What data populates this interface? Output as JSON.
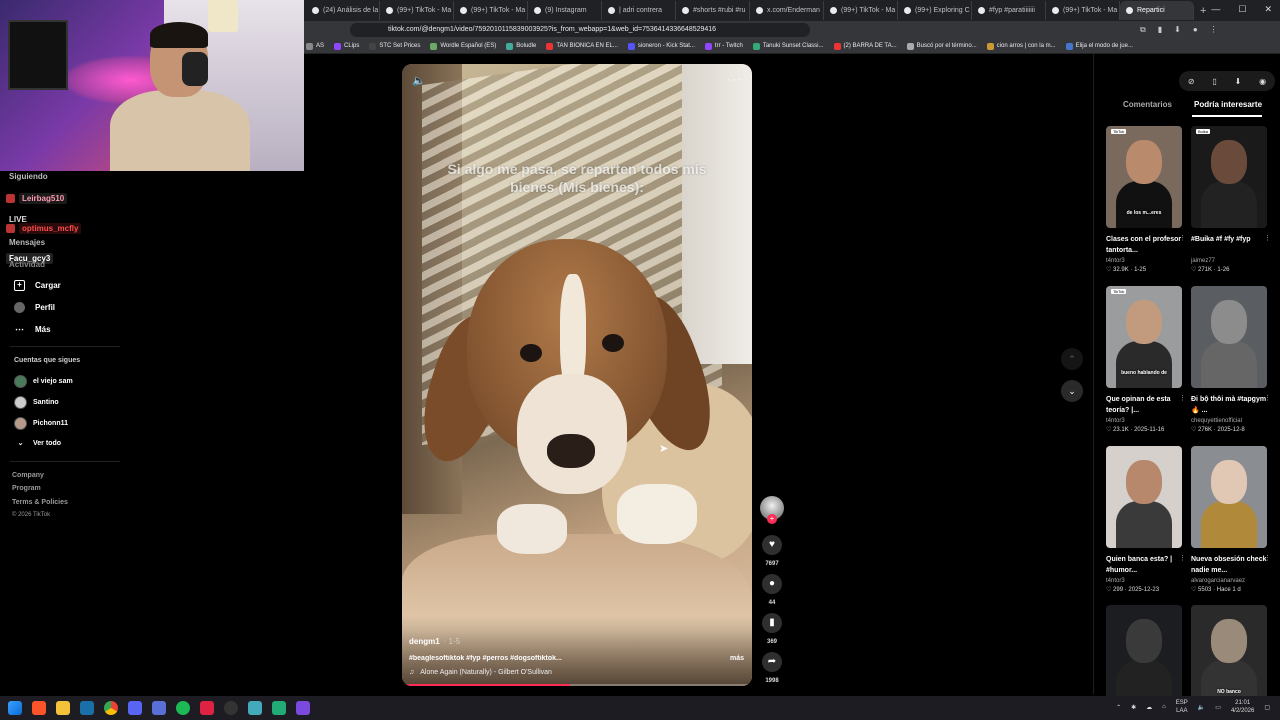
{
  "tabs": [
    {
      "label": "(24) Análisis de la",
      "active": false
    },
    {
      "label": "(99+) TikTok - Ma",
      "active": false
    },
    {
      "label": "(99+) TikTok - Ma",
      "active": false
    },
    {
      "label": "(9) Instagram",
      "active": false
    },
    {
      "label": "| adri contrera",
      "active": false
    },
    {
      "label": "#shorts #rubi #ru",
      "active": false
    },
    {
      "label": "x.com/Enderman",
      "active": false
    },
    {
      "label": "(99+) TikTok - Ma",
      "active": false
    },
    {
      "label": "(99+) Exploring C",
      "active": false
    },
    {
      "label": "#fyp #paratiiiiiii",
      "active": false
    },
    {
      "label": "(99+) TikTok - Ma",
      "active": false
    },
    {
      "label": "Repartici",
      "active": true
    }
  ],
  "address": {
    "url": "tiktok.com/@dengm1/video/7592010115839003925?is_from_webapp=1&web_id=7536414336648529416"
  },
  "bookmarks": [
    {
      "label": "AS",
      "color": "#888"
    },
    {
      "label": "CLips",
      "color": "#9146ff"
    },
    {
      "label": "STC Set Prices",
      "color": "#444"
    },
    {
      "label": "Wordle Español (ES)",
      "color": "#6aaa64"
    },
    {
      "label": "Boludle",
      "color": "#4a9"
    },
    {
      "label": "TAN BIONICA EN EL...",
      "color": "#e33"
    },
    {
      "label": "sioneron - Kick Stat...",
      "color": "#55f"
    },
    {
      "label": "trr - Twitch",
      "color": "#9146ff"
    },
    {
      "label": "Tanuki Sunset Classi...",
      "color": "#3a7"
    },
    {
      "label": "(2) BARRA DE TA...",
      "color": "#e33"
    },
    {
      "label": "Buscó por el término...",
      "color": "#aaa"
    },
    {
      "label": "cion arros | con la m...",
      "color": "#c93"
    },
    {
      "label": "Elija el modo de jue...",
      "color": "#47c"
    }
  ],
  "chat": [
    {
      "name": "Siguiendo",
      "color": "#bbb",
      "bg": "transparent"
    },
    {
      "name": "Leirbag510",
      "color": "#ff9ab0",
      "bg": "#1a1a1a"
    },
    {
      "name": "LIVE",
      "color": "#ddd",
      "bg": "transparent"
    },
    {
      "name": "optimus_mcfly",
      "color": "#ff4d4d",
      "bg": "#2a0a0a"
    },
    {
      "name": "Mensajes",
      "color": "#bbb",
      "bg": "transparent"
    },
    {
      "name": "Facu_gcy3",
      "color": "#fff",
      "bg": "#222"
    },
    {
      "name": "Actividad",
      "color": "#888",
      "bg": "transparent"
    }
  ],
  "nav": [
    {
      "label": "Cargar",
      "icon": "plus-square-icon"
    },
    {
      "label": "Perfil",
      "icon": "avatar-icon"
    },
    {
      "label": "Más",
      "icon": "more-dots-icon"
    }
  ],
  "following": {
    "title": "Cuentas que sigues",
    "accounts": [
      {
        "name": "el viejo sam"
      },
      {
        "name": "Santino"
      },
      {
        "name": "Pichonn11"
      }
    ],
    "see_all": "Ver todo"
  },
  "footer": {
    "links": [
      "Company",
      "Program",
      "Terms & Policies"
    ],
    "copyright": "© 2026 TikTok"
  },
  "video": {
    "overlay_text": "Si algo me pasa, se reparten todos mis bienes (Mis bienes):",
    "author": "dengm1",
    "date": "· 1-5",
    "hashtags": "#beaglesoftiktok #fyp #perros #dogsoftiktok...",
    "more": "más",
    "music": "Alone Again (Naturally) - Gilbert O'Sullivan",
    "progress": 0.48
  },
  "actions": {
    "likes": "7697",
    "comments": "44",
    "saves": "369",
    "shares": "1998"
  },
  "panel": {
    "tab_comments": "Comentarios",
    "tab_interest": "Podría interesarte"
  },
  "cards": [
    {
      "title": "Clases con el profesor tantorta...",
      "author": "t4ntor3",
      "likes": "32.9K",
      "date": "1-25",
      "caption": "de los m...eres",
      "tag": "TikTok",
      "bg": "#7a6a5e",
      "skin": "#b98a6c",
      "shirt": "#111"
    },
    {
      "title": "#Buika #f #fy #fyp",
      "author": "jaimez77",
      "likes": "271K",
      "date": "1-26",
      "caption": "",
      "tag": "Buika",
      "bg": "#1a1a1a",
      "skin": "#6a4a3a",
      "shirt": "#222"
    },
    {
      "title": "Que opinan de esta teoría? |...",
      "author": "t4ntor3",
      "likes": "23.1K",
      "date": "2025-11-16",
      "caption": "bueno hablando de",
      "tag": "TikTok",
      "bg": "#9a9c9e",
      "skin": "#c29a7e",
      "shirt": "#2a2a2a"
    },
    {
      "title": "Đi bộ thôi mà #tapgym 🔥 ...",
      "author": "chequyettienofficial",
      "likes": "276K",
      "date": "2025-12-8",
      "caption": "",
      "tag": "",
      "bg": "#5a5e62",
      "skin": "#8c8c8c",
      "shirt": "#666"
    },
    {
      "title": "Quien banca esta? | #humor...",
      "author": "t4ntor3",
      "likes": "299",
      "date": "2025-12-23",
      "caption": "",
      "tag": "",
      "bg": "#d6d0cc",
      "skin": "#b8886c",
      "shirt": "#3a3a3a"
    },
    {
      "title": "Nueva obsesión check nadie me...",
      "author": "alvarogarcianarvaez",
      "likes": "5503",
      "date": "Hace 1 d",
      "caption": "",
      "tag": "",
      "bg": "#8a8e92",
      "skin": "#e0c8b4",
      "shirt": "#b08a3a"
    },
    {
      "title": "",
      "author": "",
      "likes": "",
      "date": "",
      "caption": "",
      "tag": "",
      "bg": "#1b1d20",
      "skin": "#3a3a3a",
      "shirt": "#222"
    },
    {
      "title": "",
      "author": "",
      "likes": "",
      "date": "",
      "caption": "NO banco",
      "tag": "",
      "bg": "#2a2a2a",
      "skin": "#9a8a7a",
      "shirt": "#333"
    }
  ],
  "tray": {
    "lang_line1": "ESP",
    "lang_line2": "LAA",
    "time": "21:01",
    "date": "4/2/2026"
  },
  "colors": {
    "accent": "#fe2c55",
    "background": "#000000"
  }
}
